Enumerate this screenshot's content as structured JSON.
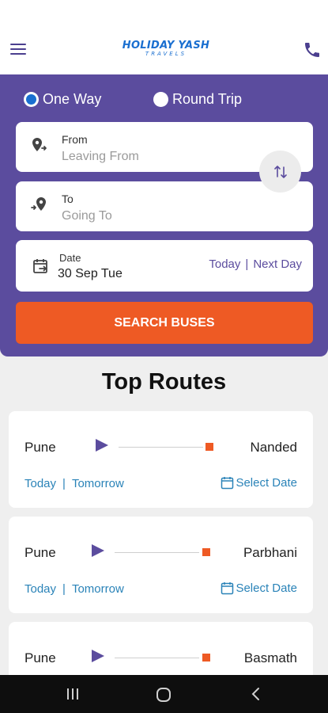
{
  "header": {
    "logo_main": "HOLIDAY YASH",
    "logo_sub": "TRAVELS",
    "menu_icon": "hamburger-menu-icon",
    "phone_icon": "phone-icon"
  },
  "trip_type": {
    "options": [
      "One Way",
      "Round Trip"
    ],
    "selected": "One Way"
  },
  "search_form": {
    "from": {
      "label": "From",
      "placeholder": "Leaving From"
    },
    "to": {
      "label": "To",
      "placeholder": "Going To"
    },
    "date": {
      "label": "Date",
      "value": "30 Sep Tue",
      "today": "Today",
      "separator": "|",
      "next_day": "Next Day"
    },
    "search_button": "SEARCH BUSES"
  },
  "top_routes": {
    "title": "Top Routes",
    "link_today": "Today",
    "link_tomorrow": "Tomorrow",
    "link_separator": "|",
    "select_date": "Select Date",
    "routes": [
      {
        "from": "Pune",
        "to": "Nanded"
      },
      {
        "from": "Pune",
        "to": "Parbhani"
      },
      {
        "from": "Pune",
        "to": "Basmath"
      }
    ]
  },
  "colors": {
    "primary": "#5b4c9e",
    "accent": "#ee5a24",
    "link": "#2a83b8",
    "logo": "#1a6fd0"
  }
}
